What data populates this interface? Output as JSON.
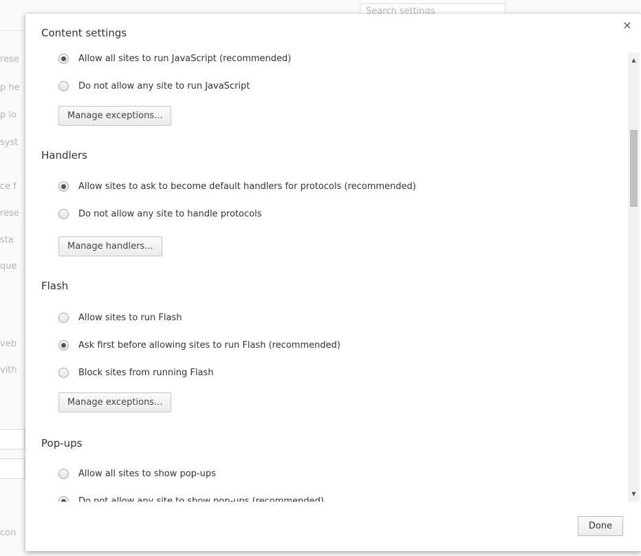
{
  "background_page": {
    "search_placeholder": "Search settings",
    "fragments": [
      "rese",
      "p he",
      "p lo",
      "syst",
      "ce f",
      "rese",
      "sta",
      "que",
      "veb",
      "vith",
      "con"
    ]
  },
  "dialog": {
    "title": "Content settings",
    "close_glyph": "×",
    "done_label": "Done",
    "sections": [
      {
        "title": "",
        "options": [
          {
            "label": "Allow all sites to run JavaScript (recommended)",
            "checked": true
          },
          {
            "label": "Do not allow any site to run JavaScript",
            "checked": false
          }
        ],
        "button": "Manage exceptions..."
      },
      {
        "title": "Handlers",
        "options": [
          {
            "label": "Allow sites to ask to become default handlers for protocols (recommended)",
            "checked": true
          },
          {
            "label": "Do not allow any site to handle protocols",
            "checked": false
          }
        ],
        "button": "Manage handlers..."
      },
      {
        "title": "Flash",
        "options": [
          {
            "label": "Allow sites to run Flash",
            "checked": false
          },
          {
            "label": "Ask first before allowing sites to run Flash (recommended)",
            "checked": true
          },
          {
            "label": "Block sites from running Flash",
            "checked": false
          }
        ],
        "button": "Manage exceptions..."
      },
      {
        "title": "Pop-ups",
        "options": [
          {
            "label": "Allow all sites to show pop-ups",
            "checked": false
          },
          {
            "label": "Do not allow any site to show pop-ups (recommended)",
            "checked": true
          }
        ]
      }
    ]
  },
  "scrollbar": {
    "up_glyph": "▲",
    "down_glyph": "▼"
  }
}
